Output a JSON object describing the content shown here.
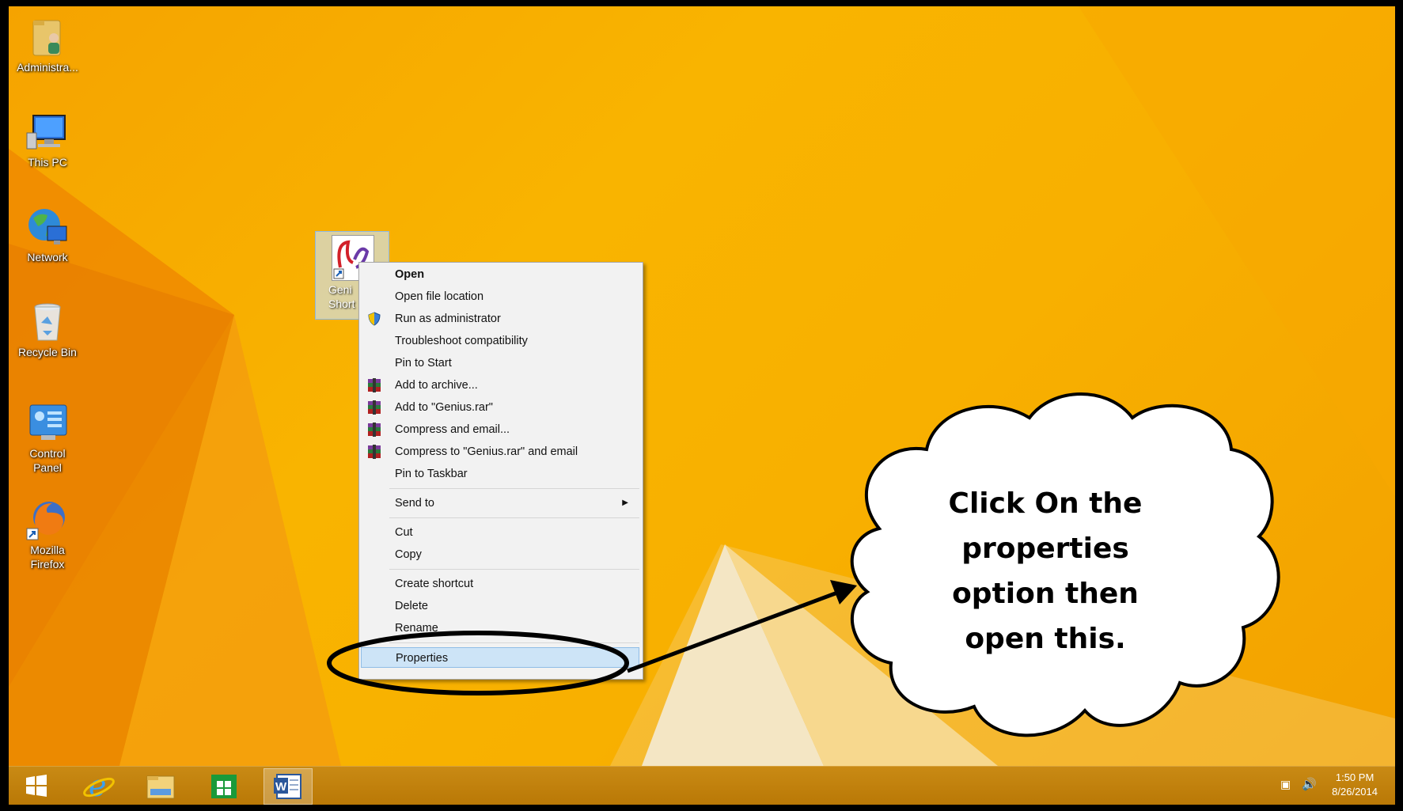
{
  "desktop_icons": [
    {
      "label": "Administra...",
      "icon": "user-folder-icon"
    },
    {
      "label": "This PC",
      "icon": "computer-icon"
    },
    {
      "label": "Network",
      "icon": "network-globe-icon"
    },
    {
      "label": "Recycle Bin",
      "icon": "recycle-bin-icon"
    },
    {
      "label": "Control Panel",
      "icon": "control-panel-icon"
    },
    {
      "label": "Mozilla Firefox",
      "icon": "firefox-icon"
    }
  ],
  "selected_shortcut": {
    "label_line1": "Geni",
    "label_line2": "Short"
  },
  "context_menu": {
    "items": [
      {
        "label": "Open",
        "bold": true
      },
      {
        "label": "Open file location"
      },
      {
        "label": "Run as administrator",
        "icon": "uac-shield-icon"
      },
      {
        "label": "Troubleshoot compatibility"
      },
      {
        "label": "Pin to Start"
      },
      {
        "label": "Add to archive...",
        "icon": "winrar-icon"
      },
      {
        "label": "Add to \"Genius.rar\"",
        "icon": "winrar-icon"
      },
      {
        "label": "Compress and email...",
        "icon": "winrar-icon"
      },
      {
        "label": "Compress to \"Genius.rar\" and email",
        "icon": "winrar-icon"
      },
      {
        "label": "Pin to Taskbar"
      },
      {
        "label": "Send to",
        "submenu": true
      },
      {
        "label": "Cut"
      },
      {
        "label": "Copy"
      },
      {
        "label": "Create shortcut"
      },
      {
        "label": "Delete"
      },
      {
        "label": "Rename"
      },
      {
        "label": "Properties",
        "highlighted": true
      }
    ]
  },
  "annotation": {
    "cloud_text_lines": [
      "Click On the",
      "properties",
      "option then",
      "open this."
    ]
  },
  "taskbar": {
    "buttons": [
      "start-button",
      "internet-explorer-icon",
      "file-explorer-icon",
      "store-icon",
      "word-icon"
    ],
    "time": "1:50 PM",
    "date": "8/26/2014"
  },
  "colors": {
    "accent": "#f8b000",
    "menu_highlight": "#cde4f7"
  }
}
